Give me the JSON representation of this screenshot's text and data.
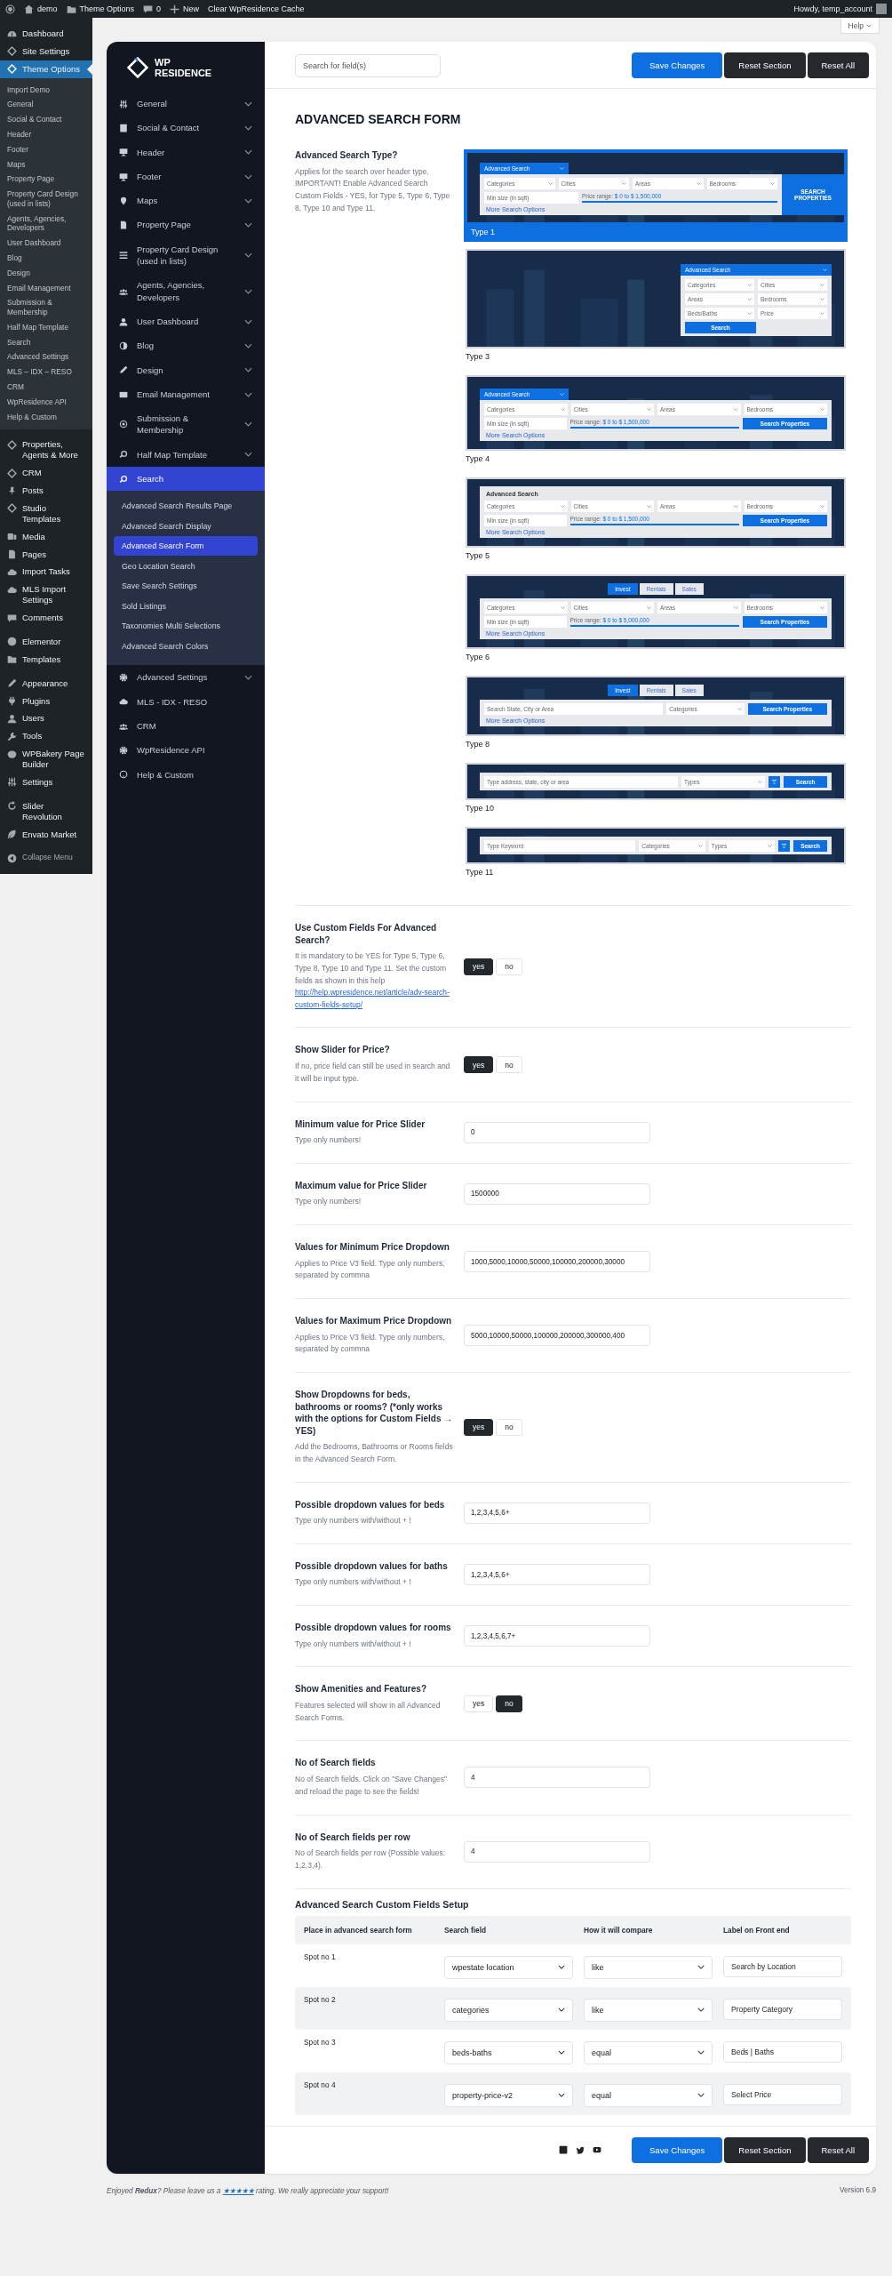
{
  "admin_bar": {
    "items": [
      {
        "kind": "logo"
      },
      {
        "kind": "home",
        "label": "demo"
      },
      {
        "kind": "folder",
        "label": "Theme Options"
      },
      {
        "kind": "comment",
        "label": "0"
      },
      {
        "kind": "plus",
        "label": "New"
      },
      {
        "kind": "text",
        "label": "Clear WpResidence Cache"
      }
    ],
    "account": "Howdy, temp_account"
  },
  "admin_menu": {
    "groups": [
      [
        {
          "label": "Dashboard",
          "selected": false
        },
        {
          "label": "Site Settings",
          "selected": false
        },
        {
          "label": "Theme Options",
          "selected": true,
          "submenu": [
            {
              "label": "Import Demo",
              "selected": false
            },
            {
              "label": "General",
              "selected": false
            },
            {
              "label": "Social & Contact",
              "selected": false
            },
            {
              "label": "Header",
              "selected": false
            },
            {
              "label": "Footer",
              "selected": false
            },
            {
              "label": "Maps",
              "selected": false
            },
            {
              "label": "Property Page",
              "selected": false
            },
            {
              "label": "Property Card Design (used in lists)",
              "selected": false
            },
            {
              "label": "Agents, Agencies, Developers",
              "selected": false
            },
            {
              "label": "User Dashboard",
              "selected": false
            },
            {
              "label": "Blog",
              "selected": false
            },
            {
              "label": "Design",
              "selected": false
            },
            {
              "label": "Email Management",
              "selected": false
            },
            {
              "label": "Submission & Membership",
              "selected": false
            },
            {
              "label": "Half Map Template",
              "selected": false
            },
            {
              "label": "Search",
              "selected": false
            },
            {
              "label": "Advanced Settings",
              "selected": false
            },
            {
              "label": "MLS – IDX – RESO",
              "selected": false
            },
            {
              "label": "CRM",
              "selected": false
            },
            {
              "label": "WpResidence API",
              "selected": false
            },
            {
              "label": "Help & Custom",
              "selected": false
            }
          ]
        }
      ],
      [
        {
          "label": "Properties, Agents & More",
          "selected": false
        },
        {
          "label": "CRM",
          "selected": false
        },
        {
          "label": "Posts",
          "selected": false
        },
        {
          "label": "Studio Templates",
          "selected": false
        },
        {
          "label": "Media",
          "selected": false
        },
        {
          "label": "Pages",
          "selected": false
        },
        {
          "label": "Import Tasks",
          "selected": false
        },
        {
          "label": "MLS Import Settings",
          "selected": false
        },
        {
          "label": "Comments",
          "selected": false
        }
      ],
      [
        {
          "label": "Elementor",
          "selected": false
        },
        {
          "label": "Templates",
          "selected": false
        }
      ],
      [
        {
          "label": "Appearance",
          "selected": false
        },
        {
          "label": "Plugins",
          "selected": false
        },
        {
          "label": "Users",
          "selected": false
        },
        {
          "label": "Tools",
          "selected": false
        },
        {
          "label": "WPBakery Page Builder",
          "selected": false
        },
        {
          "label": "Settings",
          "selected": false
        }
      ],
      [
        {
          "label": "Slider Revolution",
          "selected": false
        },
        {
          "label": "Envato Market",
          "selected": false
        }
      ]
    ],
    "collapse": "Collapse Menu"
  },
  "help_tab": "Help",
  "panel": {
    "logo": {
      "line1": "WP",
      "line2": "RESIDENCE"
    },
    "nav": [
      {
        "label": "General",
        "expandable": true,
        "selected": false
      },
      {
        "label": "Social & Contact",
        "expandable": true,
        "selected": false
      },
      {
        "label": "Header",
        "expandable": true,
        "selected": false
      },
      {
        "label": "Footer",
        "expandable": true,
        "selected": false
      },
      {
        "label": "Maps",
        "expandable": true,
        "selected": false
      },
      {
        "label": "Property Page",
        "expandable": true,
        "selected": false
      },
      {
        "label": "Property Card Design (used in lists)",
        "expandable": true,
        "selected": false
      },
      {
        "label": "Agents, Agencies, Developers",
        "expandable": true,
        "selected": false
      },
      {
        "label": "User Dashboard",
        "expandable": true,
        "selected": false
      },
      {
        "label": "Blog",
        "expandable": true,
        "selected": false
      },
      {
        "label": "Design",
        "expandable": true,
        "selected": false
      },
      {
        "label": "Email Management",
        "expandable": true,
        "selected": false
      },
      {
        "label": "Submission & Membership",
        "expandable": true,
        "selected": false
      },
      {
        "label": "Half Map Template",
        "expandable": true,
        "selected": false
      },
      {
        "label": "Search",
        "expandable": false,
        "selected": true,
        "children": [
          {
            "label": "Advanced Search Results Page",
            "selected": false
          },
          {
            "label": "Advanced Search Display",
            "selected": false
          },
          {
            "label": "Advanced Search Form",
            "selected": true
          },
          {
            "label": "Geo Location Search",
            "selected": false
          },
          {
            "label": "Save Search Settings",
            "selected": false
          },
          {
            "label": "Sold Listings",
            "selected": false
          },
          {
            "label": "Taxonomies Multi Selections",
            "selected": false
          },
          {
            "label": "Advanced Search Colors",
            "selected": false
          }
        ]
      },
      {
        "label": "Advanced Settings",
        "expandable": true,
        "selected": false
      },
      {
        "label": "MLS - IDX - RESO",
        "expandable": false,
        "selected": false
      },
      {
        "label": "CRM",
        "expandable": false,
        "selected": false
      },
      {
        "label": "WpResidence API",
        "expandable": false,
        "selected": false
      },
      {
        "label": "Help & Custom",
        "expandable": false,
        "selected": false
      }
    ],
    "search": {
      "placeholder": "Search for field(s)"
    },
    "buttons": [
      {
        "label": "Save Changes",
        "kind": "primary"
      },
      {
        "label": "Reset Section",
        "kind": "dark"
      },
      {
        "label": "Reset All",
        "kind": "dark"
      }
    ],
    "title": "ADVANCED SEARCH FORM",
    "settings": [
      {
        "kind": "image-select",
        "title": "Advanced Search Type?",
        "desc": "Applies for the search over header type. IMPORTANT! Enable Advanced Search Custom Fields - YES, for Type 5, Type 6, Type 8, Type 10 and Type 11.",
        "options": [
          {
            "label": "Type 1",
            "selected": true,
            "preview": {
              "kind": "side",
              "header": "Advanced Search",
              "lines": [
                [
                  {
                    "kind": "select",
                    "text": "Categories"
                  },
                  {
                    "kind": "select",
                    "text": "Cities"
                  },
                  {
                    "kind": "select",
                    "text": "Areas"
                  },
                  {
                    "kind": "select",
                    "text": "Bedrooms"
                  }
                ],
                [
                  {
                    "kind": "input",
                    "text": "Min size (in sqft)"
                  },
                  {
                    "kind": "range",
                    "label": "Price range:",
                    "text": "$ 0 to $ 1,500,000"
                  }
                ]
              ],
              "more": "More Search Options",
              "side_button": "SEARCH PROPERTIES"
            }
          },
          {
            "label": "Type 3",
            "selected": false,
            "preview": {
              "kind": "panel",
              "header": "Advanced Search",
              "lines": [
                [
                  {
                    "kind": "select",
                    "text": "Categories"
                  },
                  {
                    "kind": "select",
                    "text": "Cities"
                  }
                ],
                [
                  {
                    "kind": "select",
                    "text": "Areas"
                  },
                  {
                    "kind": "select",
                    "text": "Bedrooms"
                  }
                ],
                [
                  {
                    "kind": "select",
                    "text": "Beds/Baths"
                  },
                  {
                    "kind": "select",
                    "text": "Price"
                  }
                ],
                [
                  {
                    "kind": "button",
                    "text": "Search"
                  }
                ]
              ]
            }
          },
          {
            "label": "Type 4",
            "selected": false,
            "preview": {
              "kind": "full",
              "header": "Advanced Search",
              "lines": [
                [
                  {
                    "kind": "select",
                    "text": "Categories"
                  },
                  {
                    "kind": "select",
                    "text": "Cities"
                  },
                  {
                    "kind": "select",
                    "text": "Areas"
                  },
                  {
                    "kind": "select",
                    "text": "Bedrooms"
                  }
                ],
                [
                  {
                    "kind": "input",
                    "text": "Min size (in sqft)"
                  },
                  {
                    "kind": "range",
                    "label": "Price range:",
                    "text": "$ 0 to $ 1,500,000"
                  },
                  {
                    "kind": "button",
                    "text": "Search Properties"
                  }
                ]
              ],
              "more": "More Search Options"
            }
          },
          {
            "label": "Type 5",
            "selected": false,
            "preview": {
              "kind": "full",
              "title": "Advanced Search",
              "lines": [
                [
                  {
                    "kind": "select",
                    "text": "Categories"
                  },
                  {
                    "kind": "select",
                    "text": "Cities"
                  },
                  {
                    "kind": "select",
                    "text": "Areas"
                  },
                  {
                    "kind": "select",
                    "text": "Bedrooms"
                  }
                ],
                [
                  {
                    "kind": "input",
                    "text": "Min size (in sqft)"
                  },
                  {
                    "kind": "range",
                    "label": "Price range:",
                    "text": "$ 0 to $ 1,500,000"
                  },
                  {
                    "kind": "button",
                    "text": "Search Properties"
                  }
                ]
              ],
              "more": "More Search Options"
            }
          },
          {
            "label": "Type 6",
            "selected": false,
            "preview": {
              "kind": "full",
              "tabs": [
                {
                  "text": "Invest",
                  "selected": true
                },
                {
                  "text": "Rentals",
                  "selected": false
                },
                {
                  "text": "Sales",
                  "selected": false
                }
              ],
              "lines": [
                [
                  {
                    "kind": "select",
                    "text": "Categories"
                  },
                  {
                    "kind": "select",
                    "text": "Cities"
                  },
                  {
                    "kind": "select",
                    "text": "Areas"
                  },
                  {
                    "kind": "select",
                    "text": "Bedrooms"
                  }
                ],
                [
                  {
                    "kind": "input",
                    "text": "Min size (in sqft)"
                  },
                  {
                    "kind": "range",
                    "label": "Price range:",
                    "text": "$ 0 to $ 5,000,000"
                  },
                  {
                    "kind": "button",
                    "text": "Search Properties"
                  }
                ]
              ],
              "more": "More Search Options"
            }
          },
          {
            "label": "Type 8",
            "selected": false,
            "preview": {
              "kind": "full",
              "tabs": [
                {
                  "text": "Invest",
                  "selected": true
                },
                {
                  "text": "Rentals",
                  "selected": false
                },
                {
                  "text": "Sales",
                  "selected": false
                }
              ],
              "lines": [
                [
                  {
                    "kind": "input",
                    "text": "Search State, City or Area",
                    "wide": true
                  },
                  {
                    "kind": "select",
                    "text": "Categories"
                  },
                  {
                    "kind": "button",
                    "text": "Search Properties"
                  }
                ]
              ],
              "more": "More Search Options"
            }
          },
          {
            "label": "Type 10",
            "selected": false,
            "preview": {
              "kind": "bar",
              "lines": [
                [
                  {
                    "kind": "input",
                    "text": "Type address, state, city or area",
                    "wide": true
                  },
                  {
                    "kind": "select",
                    "text": "Types"
                  },
                  {
                    "kind": "icon-button"
                  },
                  {
                    "kind": "button",
                    "text": "Search"
                  }
                ]
              ]
            }
          },
          {
            "label": "Type 11",
            "selected": false,
            "preview": {
              "kind": "bar",
              "lines": [
                [
                  {
                    "kind": "input",
                    "text": "Type Keyword",
                    "wide": true
                  },
                  {
                    "kind": "select",
                    "text": "Categories"
                  },
                  {
                    "kind": "select",
                    "text": "Types"
                  },
                  {
                    "kind": "icon-button"
                  },
                  {
                    "kind": "button",
                    "text": "Search"
                  }
                ]
              ]
            }
          }
        ]
      },
      {
        "kind": "toggle",
        "title": "Use Custom Fields For Advanced Search?",
        "desc": "It is mandatory to be YES for Type 5, Type 6, Type 8, Type 10 and Type 11. Set the custom fields as shown in this help",
        "link": "http://help.wpresidence.net/article/adv-search-custom-fields-setup/",
        "options": [
          {
            "label": "yes",
            "selected": true
          },
          {
            "label": "no",
            "selected": false
          }
        ]
      },
      {
        "kind": "toggle",
        "title": "Show Slider for Price?",
        "desc": "If no, price field can still be used in search and it will be input type.",
        "options": [
          {
            "label": "yes",
            "selected": true
          },
          {
            "label": "no",
            "selected": false
          }
        ]
      },
      {
        "kind": "text",
        "title": "Minimum value for Price Slider",
        "desc": "Type only numbers!",
        "value": "0"
      },
      {
        "kind": "text",
        "title": "Maximum value for Price Slider",
        "desc": "Type only numbers!",
        "value": "1500000"
      },
      {
        "kind": "text",
        "title": "Values for Minimum Price Dropdown",
        "desc": "Applies to Price V3 field. Type only numbers, separated by commna",
        "value": "1000,5000,10000,50000,100000,200000,30000"
      },
      {
        "kind": "text",
        "title": "Values for Maximum Price Dropdown",
        "desc": "Applies to Price V3 field. Type only numbers, separated by commna",
        "value": "5000,10000,50000,100000,200000,300000,400"
      },
      {
        "kind": "toggle",
        "title": "Show Dropdowns for beds, bathrooms or rooms? (*only works with the options for Custom Fields → YES)",
        "desc": "Add the Bedrooms, Bathrooms or Rooms fields in the Advanced Search Form.",
        "options": [
          {
            "label": "yes",
            "selected": true
          },
          {
            "label": "no",
            "selected": false
          }
        ]
      },
      {
        "kind": "text",
        "title": "Possible dropdown values for beds",
        "desc": "Type only numbers with/without + !",
        "value": "1,2,3,4,5,6+"
      },
      {
        "kind": "text",
        "title": "Possible dropdown values for baths",
        "desc": "Type only numbers with/without + !",
        "value": "1,2,3,4,5,6+"
      },
      {
        "kind": "text",
        "title": "Possible dropdown values for rooms",
        "desc": "Type only numbers with/without + !",
        "value": "1,2,3,4,5,6,7+"
      },
      {
        "kind": "toggle",
        "title": "Show Amenities and Features?",
        "desc": "Features selected will show in all Advanced Search Forms.",
        "options": [
          {
            "label": "yes",
            "selected": false
          },
          {
            "label": "no",
            "selected": true
          }
        ]
      },
      {
        "kind": "text",
        "title": "No of Search fields",
        "desc": "No of Search fields. Click on \"Save Changes\" and reload the page to see the fields!",
        "value": "4"
      },
      {
        "kind": "text",
        "title": "No of Search fields per row",
        "desc": "No of Search fields per row (Possible values: 1,2,3,4).",
        "value": "4"
      }
    ],
    "custom_fields": {
      "title": "Advanced Search Custom Fields Setup",
      "columns": [
        "Place in advanced search form",
        "Search field",
        "How it will compare",
        "Label on Front end"
      ],
      "rows": [
        {
          "spot": "Spot no 1",
          "field": "wpestate location",
          "compare": "like",
          "label": "Search by Location"
        },
        {
          "spot": "Spot no 2",
          "field": "categories",
          "compare": "like",
          "label": "Property Category"
        },
        {
          "spot": "Spot no 3",
          "field": "beds-baths",
          "compare": "equal",
          "label": "Beds | Baths"
        },
        {
          "spot": "Spot no 4",
          "field": "property-price-v2",
          "compare": "equal",
          "label": "Select Price"
        }
      ]
    },
    "footer_buttons": [
      {
        "label": "Save Changes",
        "kind": "primary"
      },
      {
        "label": "Reset Section",
        "kind": "dark"
      },
      {
        "label": "Reset All",
        "kind": "dark"
      }
    ]
  },
  "credit": {
    "before": "Enjoyed **Redux**? Please leave us a",
    "link": "★★★★★",
    "after": "rating. We really appreciate your support!"
  },
  "version": "Version 6.9"
}
